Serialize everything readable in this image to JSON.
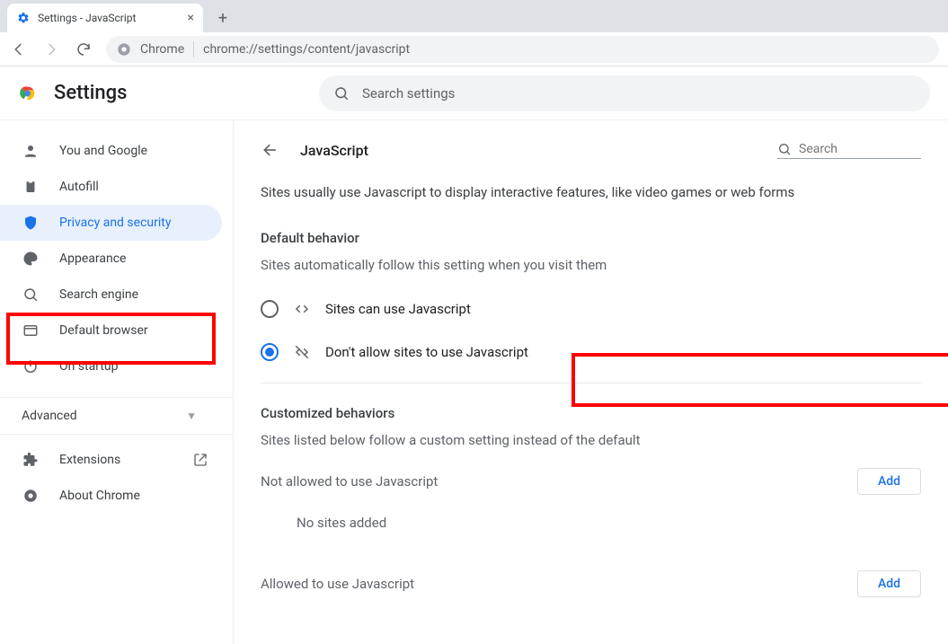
{
  "browser": {
    "tabTitle": "Settings - JavaScript",
    "urlScheme": "Chrome",
    "url": "chrome://settings/content/javascript"
  },
  "header": {
    "title": "Settings",
    "searchPlaceholder": "Search settings"
  },
  "sidebar": {
    "items": [
      {
        "label": "You and Google"
      },
      {
        "label": "Autofill"
      },
      {
        "label": "Privacy and security"
      },
      {
        "label": "Appearance"
      },
      {
        "label": "Search engine"
      },
      {
        "label": "Default browser"
      },
      {
        "label": "On startup"
      }
    ],
    "advanced": "Advanced",
    "extensions": "Extensions",
    "about": "About Chrome"
  },
  "content": {
    "pageTitle": "JavaScript",
    "searchPlaceholder": "Search",
    "description": "Sites usually use Javascript to display interactive features, like video games or web forms",
    "default": {
      "heading": "Default behavior",
      "sub": "Sites automatically follow this setting when you visit them",
      "allow": "Sites can use Javascript",
      "block": "Don't allow sites to use Javascript"
    },
    "custom": {
      "heading": "Customized behaviors",
      "sub": "Sites listed below follow a custom setting instead of the default",
      "notAllowed": "Not allowed to use Javascript",
      "allowed": "Allowed to use Javascript",
      "empty": "No sites added",
      "add": "Add"
    }
  }
}
